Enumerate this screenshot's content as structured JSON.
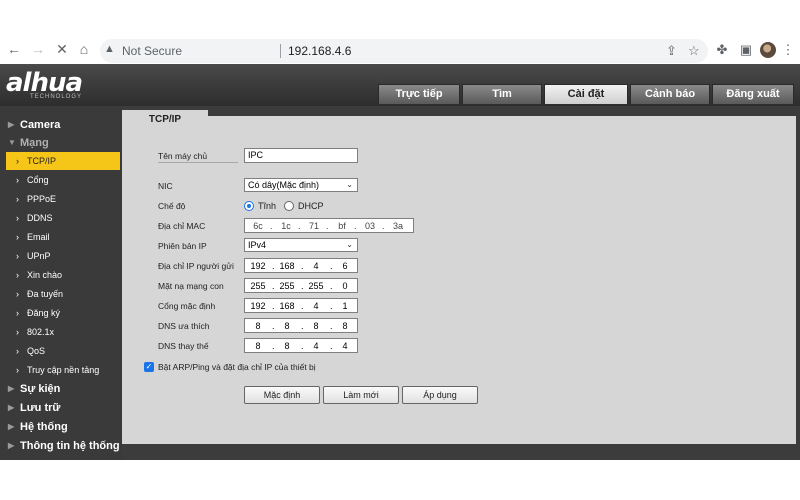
{
  "browser": {
    "security_label": "Not Secure",
    "url": "192.168.4.6",
    "icons": [
      "back-icon",
      "forward-icon",
      "stop-loading-icon",
      "home-icon",
      "warning-icon",
      "share-icon",
      "bookmark-star-icon",
      "extensions-icon",
      "sidebar-icon",
      "avatar",
      "menu-icon"
    ]
  },
  "header": {
    "logo": "alhua",
    "logo_sub": "TECHNOLOGY",
    "tabs": [
      {
        "label": "Trực tiếp"
      },
      {
        "label": "Tìm"
      },
      {
        "label": "Cài đặt",
        "active": true
      },
      {
        "label": "Cảnh báo"
      },
      {
        "label": "Đăng xuất"
      }
    ]
  },
  "sidebar": {
    "items": [
      {
        "label": "Camera",
        "type": "category"
      },
      {
        "label": "Mạng",
        "type": "category",
        "expanded": true
      },
      {
        "label": "TCP/IP",
        "type": "sub",
        "selected": true
      },
      {
        "label": "Cổng",
        "type": "sub"
      },
      {
        "label": "PPPoE",
        "type": "sub"
      },
      {
        "label": "DDNS",
        "type": "sub"
      },
      {
        "label": "Email",
        "type": "sub"
      },
      {
        "label": "UPnP",
        "type": "sub"
      },
      {
        "label": "Xin chào",
        "type": "sub"
      },
      {
        "label": "Đa tuyến",
        "type": "sub"
      },
      {
        "label": "Đăng ký",
        "type": "sub"
      },
      {
        "label": "802.1x",
        "type": "sub"
      },
      {
        "label": "QoS",
        "type": "sub"
      },
      {
        "label": "Truy cập nền tảng",
        "type": "sub"
      },
      {
        "label": "Sự kiện",
        "type": "category"
      },
      {
        "label": "Lưu trữ",
        "type": "category"
      },
      {
        "label": "Hệ thống",
        "type": "category"
      },
      {
        "label": "Thông tin hệ thống",
        "type": "category"
      }
    ]
  },
  "content": {
    "tab_label": "TCP/IP",
    "labels": {
      "hostname": "Tên máy chủ",
      "nic": "NIC",
      "mode": "Chế độ",
      "mac": "Địa chỉ MAC",
      "ip_version": "Phiên bản IP",
      "ip": "Địa chỉ IP người gửi",
      "subnet": "Mặt nạ mạng con",
      "gateway": "Cổng mặc định",
      "dns_pref": "DNS ưa thích",
      "dns_alt": "DNS thay thế"
    },
    "hostname_value": "IPC",
    "nic_value": "Có dây(Mặc định)",
    "mode_options": {
      "static": "Tĩnh",
      "dhcp": "DHCP",
      "selected": "static"
    },
    "mac": [
      "6c",
      "1c",
      "71",
      "bf",
      "03",
      "3a"
    ],
    "ip_version_value": "IPv4",
    "ip": [
      "192",
      "168",
      "4",
      "6"
    ],
    "subnet": [
      "255",
      "255",
      "255",
      "0"
    ],
    "gateway": [
      "192",
      "168",
      "4",
      "1"
    ],
    "dns_pref": [
      "8",
      "8",
      "8",
      "8"
    ],
    "dns_alt": [
      "8",
      "8",
      "4",
      "4"
    ],
    "arp_ping_label": "Bật ARP/Ping và đặt địa chỉ IP của thiết bị",
    "arp_ping_checked": true,
    "buttons": {
      "default": "Mặc định",
      "refresh": "Làm mới",
      "apply": "Áp dụng"
    }
  }
}
